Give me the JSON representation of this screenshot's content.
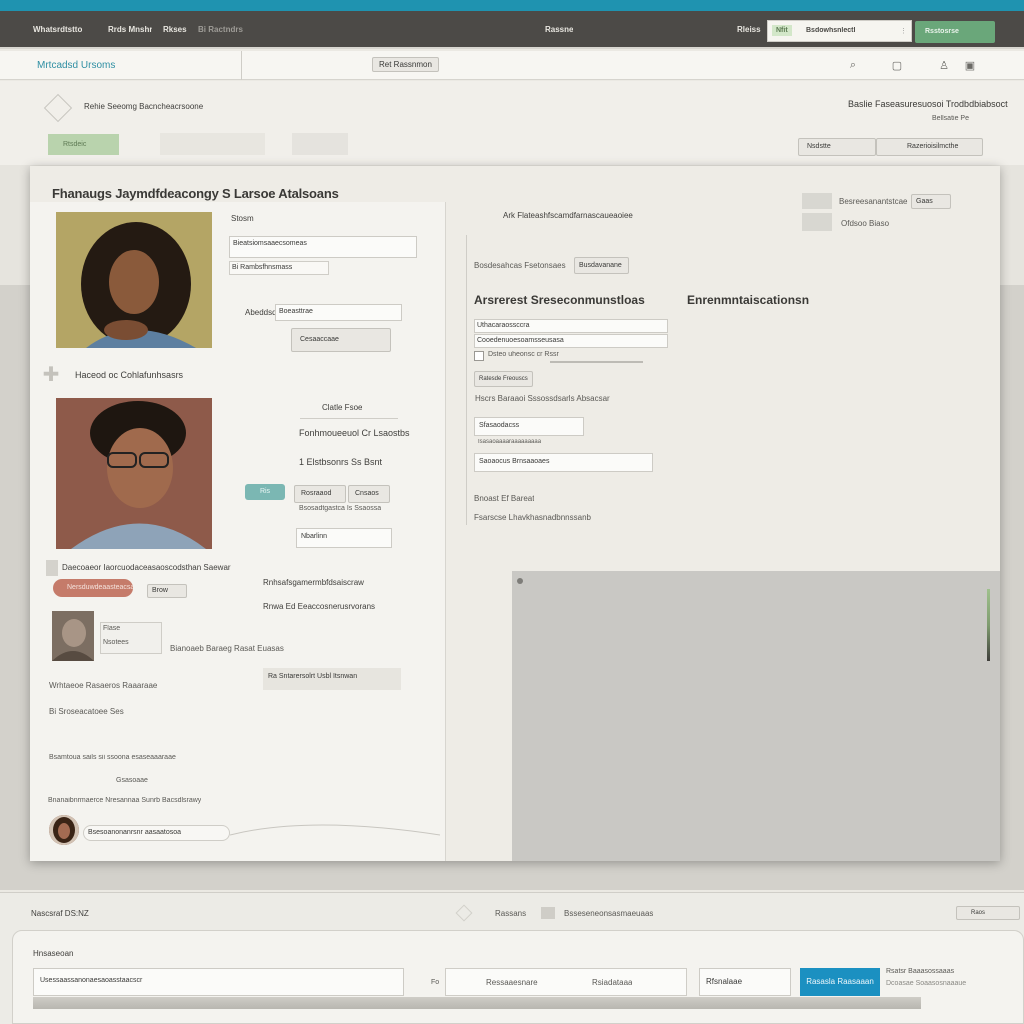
{
  "topbar": {
    "left_label": "Whatsrdtstto",
    "menu": [
      "Rrds Mnshr",
      "Rkses",
      "Bi Ractndrs"
    ],
    "center_label": "Rassne",
    "right_label": "Rleiss",
    "search_tag": "Nfit",
    "search_value": "Bsdowhsnlectl",
    "search_btn": "Rsstosrse"
  },
  "subbar": {
    "brand": "Mrtcadsd Ursoms",
    "tab": "Ret Rassnmon"
  },
  "header": {
    "breadcrumb": "Rehie Seeomg Bacncheacrsoone",
    "left_button": "Rtsdeic",
    "right_title": "Baslie Faseasuresuosoi Trodbdbiabsoct",
    "right_sub": "Bellsatie Pe",
    "btn_a": "Nsdstte",
    "btn_b": "Razerioisilmcthe"
  },
  "panel": {
    "title": "Fhanaugs Jaymdfdeacongy S Larsoe Atalsoans",
    "profile1": {
      "label": "Stosm",
      "field1": "Bieatsiomsaaecsomeas",
      "field2": "Bi Rambsfhnsmass",
      "row_label": "Abeddsd",
      "row_value": "Boeasttrae",
      "button": "Cesaaccaae"
    },
    "section2": "Haceod oc Cohlafunhsasrs",
    "profile2": {
      "title": "Clatle Fsoe",
      "line1": "Fonhmoueeuol Cr Lsaostbs",
      "line2": "1 Elstbsonrs Ss Bsnt",
      "tag": "Ris",
      "chip1": "Rosraaod",
      "chip2": "Cnsaos",
      "line3": "Bsosadtgastca Is Ssaossa",
      "field": "Nbarlinn"
    },
    "footer_left": {
      "line1": "Daecoaeor Iaorcuodaceasaoscodsthan Saewar",
      "pill": "Nersduwdeaasteacsa",
      "tag": "Brow",
      "right1": "Rnhsafsgamermbfdsaiscraw",
      "right2": "Rnwa Ed Eeaccosnerusrvorans",
      "card_tag": "Flase",
      "card_tag2": "Nsotees",
      "card_text": "Bianoaeb Baraeg Rasat Euasas",
      "item1": "Wrhtaeoe Rasaeros Raaaraae",
      "item2": "Bi Sroseacatoee Ses",
      "badge": "Ra Sntarersolrt Usbl Itsnwan",
      "list1": "Bsamtoua sails sii  ssoona esaseaaaraae",
      "list2": "Gsasoaae",
      "list3": "Bnanaibnrmaerce Nresannaa Sunrb Bacsdlsrawy",
      "avatar_label": "Bsesoanonanrsnr aasaatosoa"
    },
    "mid": {
      "title": "Ark Flateashfscamdfarnascaueaoiee",
      "chip_a": "Bosdesahcas Fsetonsaes",
      "chip_b": "Busdavanane",
      "heading": "Arsrerest Sreseconmunstloas",
      "heading2": "Enrenmntaiscationsn",
      "field1": "Uthacaraossccra",
      "field2": "Cooedenuoesoamsseusasa",
      "checkbox": "Dsteo uheonsc cr Rssr",
      "small_btn": "Ratesde Freouscs",
      "note": "Hscrs Baraaoi Sssossdsarls Absacsar",
      "field3": "Sfasaodacss",
      "sub": "Isasaoaaaaraaaaaaaaa",
      "field4": "Saoaocus Brnsaaoaes",
      "label_a": "Bnoast Ef Bareat",
      "label_b": "Fsarscse Lhavkhasnadbnnssanb"
    },
    "right_small": {
      "row1": "Besreesanantstcae",
      "row1_btn": "Gaas",
      "row2": "Ofdsoo Biaso"
    }
  },
  "footer": {
    "label": "Nascsraf DS:NZ",
    "crumb1": "Rassans",
    "crumb2": "Bsseseneonsasmaeuaas",
    "right_btn": "Raos",
    "card_title": "Hnsaseoan",
    "input_value": "Usessaassanonaesaoasstaacscr",
    "mid_label": "Fo",
    "box_a": "Ressaaesnare",
    "box_b": "Rsiadataaa",
    "box_c": "Rfsnalaae",
    "primary_btn": "Rasasla Raasaaan",
    "side_text1": "Rsatsr Baaasossaaas",
    "side_text2": "Dcoasae Soaasosnaaaue"
  }
}
